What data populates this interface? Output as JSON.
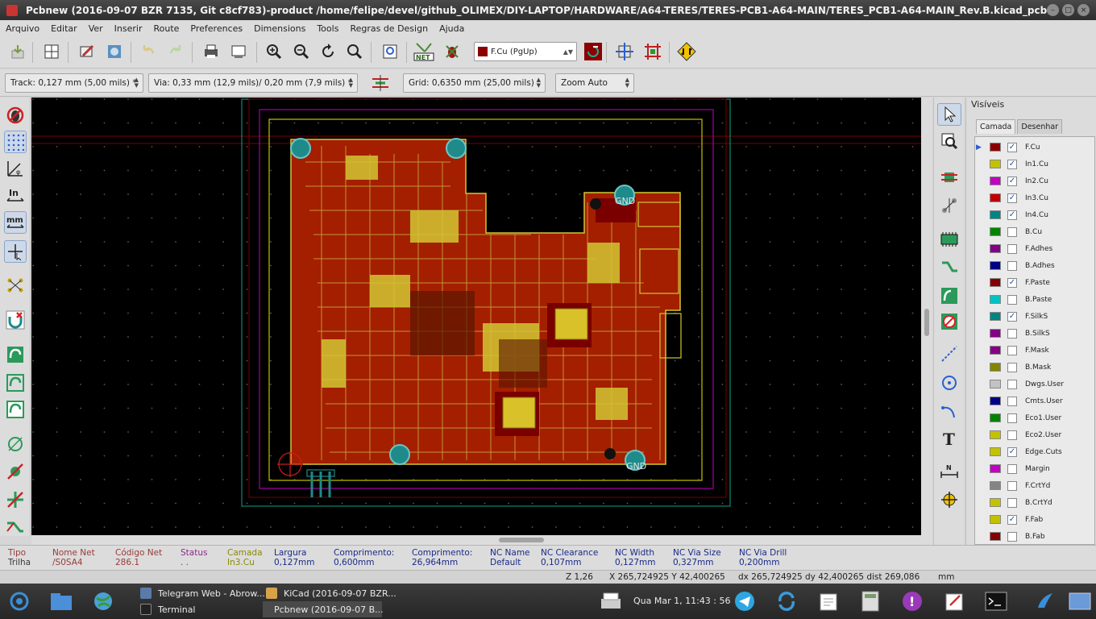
{
  "window": {
    "title": "Pcbnew (2016-09-07 BZR 7135, Git c8cf783)-product /home/felipe/devel/github_OLIMEX/DIY-LAPTOP/HARDWARE/A64-TERES/TERES-PCB1-A64-MAIN/TERES_PCB1-A64-MAIN_Rev.B.kicad_pcb"
  },
  "menu": [
    "Arquivo",
    "Editar",
    "Ver",
    "Inserir",
    "Route",
    "Preferences",
    "Dimensions",
    "Tools",
    "Regras de Design",
    "Ajuda"
  ],
  "toolbar": {
    "layer_select": "F.Cu (PgUp)",
    "track": "Track: 0,127 mm (5,00 mils) *",
    "via": "Via: 0,33 mm (12,9 mils)/ 0,20 mm (7,9 mils) *",
    "grid": "Grid: 0,6350 mm (25,00 mils)",
    "zoom": "Zoom Auto"
  },
  "layers_panel": {
    "title": "Visíveis",
    "tabs": [
      "Camada",
      "Desenhar"
    ],
    "items": [
      {
        "name": "F.Cu",
        "color": "#8b0000",
        "checked": true,
        "current": true
      },
      {
        "name": "In1.Cu",
        "color": "#c2c200",
        "checked": true
      },
      {
        "name": "In2.Cu",
        "color": "#c200c2",
        "checked": true
      },
      {
        "name": "In3.Cu",
        "color": "#c20000",
        "checked": true
      },
      {
        "name": "In4.Cu",
        "color": "#008484",
        "checked": true
      },
      {
        "name": "B.Cu",
        "color": "#008400",
        "checked": false
      },
      {
        "name": "F.Adhes",
        "color": "#840084",
        "checked": false
      },
      {
        "name": "B.Adhes",
        "color": "#000084",
        "checked": false
      },
      {
        "name": "F.Paste",
        "color": "#840000",
        "checked": true
      },
      {
        "name": "B.Paste",
        "color": "#00c2c2",
        "checked": false
      },
      {
        "name": "F.SilkS",
        "color": "#008484",
        "checked": true
      },
      {
        "name": "B.SilkS",
        "color": "#840084",
        "checked": false
      },
      {
        "name": "F.Mask",
        "color": "#840084",
        "checked": false
      },
      {
        "name": "B.Mask",
        "color": "#848400",
        "checked": false
      },
      {
        "name": "Dwgs.User",
        "color": "#c2c2c2",
        "checked": false
      },
      {
        "name": "Cmts.User",
        "color": "#000084",
        "checked": false
      },
      {
        "name": "Eco1.User",
        "color": "#008400",
        "checked": false
      },
      {
        "name": "Eco2.User",
        "color": "#c2c200",
        "checked": false
      },
      {
        "name": "Edge.Cuts",
        "color": "#c2c200",
        "checked": true
      },
      {
        "name": "Margin",
        "color": "#c200c2",
        "checked": false
      },
      {
        "name": "F.CrtYd",
        "color": "#848484",
        "checked": false
      },
      {
        "name": "B.CrtYd",
        "color": "#c2c200",
        "checked": false
      },
      {
        "name": "F.Fab",
        "color": "#c2c200",
        "checked": true
      },
      {
        "name": "B.Fab",
        "color": "#840000",
        "checked": false
      }
    ]
  },
  "board": {
    "pad_labels": [
      "GND",
      "GND"
    ]
  },
  "message_panel": {
    "tipo": {
      "label": "Tipo",
      "value": "Trilha"
    },
    "nome_net": {
      "label": "Nome Net",
      "value": "/S0SA4"
    },
    "codigo_net": {
      "label": "Código Net",
      "value": "286.1"
    },
    "status": {
      "label": "Status",
      "value": ". ."
    },
    "camada": {
      "label": "Camada",
      "value": "In3.Cu"
    },
    "largura": {
      "label": "Largura",
      "value": "0,127mm"
    },
    "comprimento1": {
      "label": "Comprimento:",
      "value": "0,600mm"
    },
    "comprimento2": {
      "label": "Comprimento:",
      "value": "26,964mm"
    },
    "nc_name": {
      "label": "NC Name",
      "value": "Default"
    },
    "nc_clearance": {
      "label": "NC Clearance",
      "value": "0,107mm"
    },
    "nc_width": {
      "label": "NC Width",
      "value": "0,127mm"
    },
    "nc_via_size": {
      "label": "NC Via Size",
      "value": "0,327mm"
    },
    "nc_via_drill": {
      "label": "NC Via Drill",
      "value": "0,200mm"
    }
  },
  "status": {
    "zoom": "Z 1,26",
    "xy": "X 265,724925  Y 42,400265",
    "dxy": "dx 265,724925  dy 42,400265  dist 269,086",
    "units": "mm"
  },
  "taskbar": {
    "tasks": [
      "Telegram Web - Abrow...",
      "Terminal",
      "KiCad (2016-09-07 BZR...",
      "Pcbnew (2016-09-07 B..."
    ],
    "clock": "Qua Mar  1, 11:43 : 56"
  },
  "colors": {
    "copper": "#a31f00",
    "copper_track": "#c8a23a",
    "silkscreen": "#d3c633",
    "pad_teal": "#1f8a8a",
    "edge": "#c2c200",
    "margin": "#9a009a",
    "courtyard": "#16a08a"
  }
}
